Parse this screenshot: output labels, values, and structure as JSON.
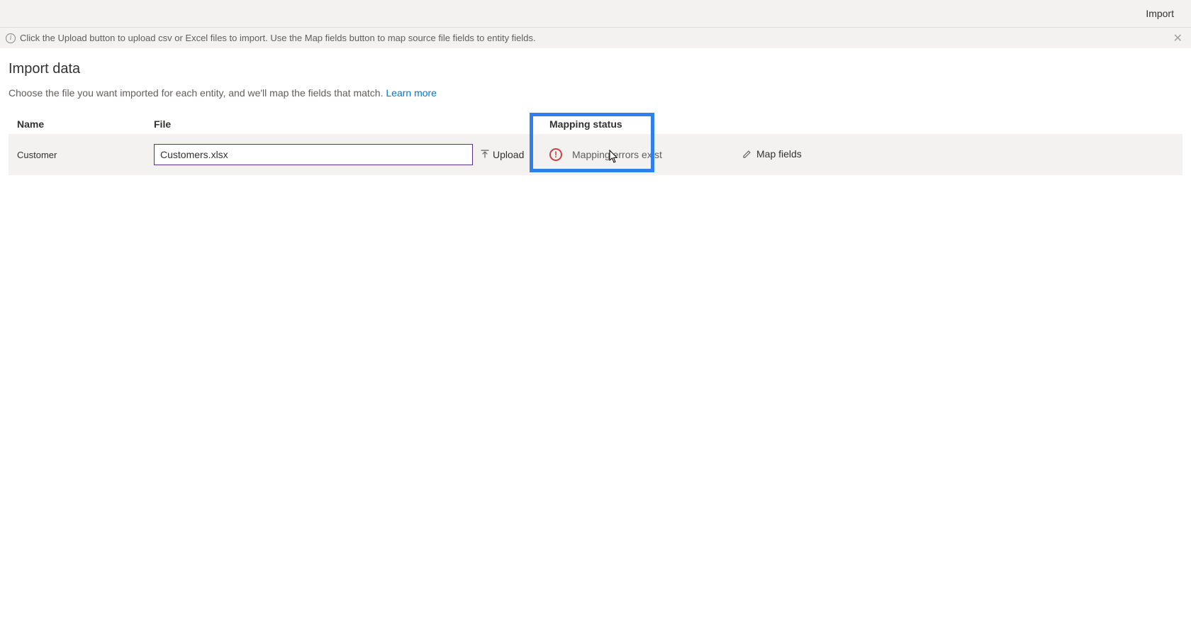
{
  "topbar": {
    "import_label": "Import"
  },
  "infobar": {
    "text": "Click the Upload button to upload csv or Excel files to import. Use the Map fields button to map source file fields to entity fields."
  },
  "page": {
    "title": "Import data",
    "description": "Choose the file you want imported for each entity, and we'll map the fields that match. ",
    "learn_more": "Learn more"
  },
  "table": {
    "headers": {
      "name": "Name",
      "file": "File",
      "mapping_status": "Mapping status"
    },
    "row": {
      "name": "Customer",
      "file_value": "Customers.xlsx",
      "upload_label": "Upload",
      "status_text": "Mapping errors exist",
      "map_fields_label": "Map fields"
    }
  }
}
